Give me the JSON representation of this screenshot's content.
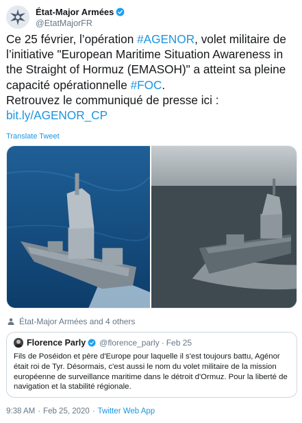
{
  "author": {
    "display_name": "État-Major Armées",
    "handle": "@EtatMajorFR",
    "avatar_icon": "emblem-avatar-icon",
    "verified_icon": "verified-badge-icon"
  },
  "tweet": {
    "text_1": "Ce 25 février, l’opération ",
    "hashtag_1": "#AGENOR",
    "text_2": ", volet militaire de l’initiative \"European Maritime Situation Awareness in the Straight of Hormuz (EMASOH)\" a atteint sa pleine capacité opérationnelle ",
    "hashtag_2": "#FOC",
    "text_3": ".",
    "text_4": "Retrouvez le communiqué de presse ici : ",
    "link": "bit.ly/AGENOR_CP"
  },
  "translate_label": "Translate Tweet",
  "media": [
    {
      "icon": "frigate-photo"
    },
    {
      "icon": "frigate-photo"
    }
  ],
  "tagged": {
    "icon": "person-icon",
    "text": "État-Major Armées and 4 others"
  },
  "quote": {
    "display_name": "Florence Parly",
    "handle": "@florence_parly",
    "separator": "·",
    "date": "Feb 25",
    "text": "Fils de Poséidon et père d'Europe pour laquelle il s'est toujours battu, Agénor était roi de Tyr. Désormais, c'est aussi le nom du volet militaire de la mission européenne de surveillance maritime dans le détroit d'Ormuz. Pour la liberté de navigation et la stabilité régionale."
  },
  "meta": {
    "time": "9:38 AM",
    "separator": "·",
    "date": "Feb 25, 2020",
    "source": "Twitter Web App"
  },
  "colors": {
    "link": "#1b95e0",
    "muted": "#657786",
    "text": "#14171a",
    "border": "#ccd6dd"
  }
}
